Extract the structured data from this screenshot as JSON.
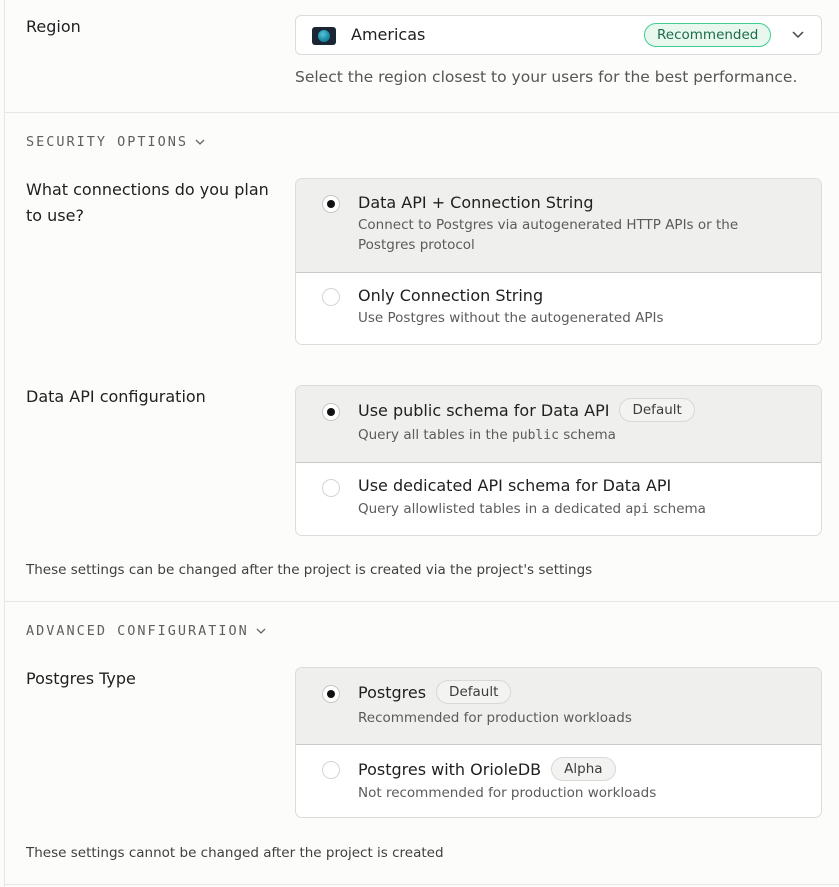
{
  "region": {
    "label": "Region",
    "value": "Americas",
    "badge": "Recommended",
    "help": "Select the region closest to your users for the best performance."
  },
  "security": {
    "heading": "SECURITY OPTIONS",
    "connections": {
      "label_line1": "What connections do you plan",
      "label_line2": "to use?",
      "options": [
        {
          "title": "Data API + Connection String",
          "desc": "Connect to Postgres via autogenerated HTTP APIs or the Postgres protocol",
          "selected": true
        },
        {
          "title": "Only Connection String",
          "desc": "Use Postgres without the autogenerated APIs",
          "selected": false
        }
      ]
    },
    "data_api": {
      "label": "Data API configuration",
      "options": [
        {
          "title": "Use public schema for Data API",
          "badge": "Default",
          "desc_pre": "Query all tables in the",
          "desc_code": "public",
          "desc_post": "schema",
          "selected": true
        },
        {
          "title": "Use dedicated API schema for Data API",
          "desc_pre": "Query allowlisted tables in a dedicated",
          "desc_code": "api",
          "desc_post": "schema",
          "selected": false
        }
      ]
    },
    "note": "These settings can be changed after the project is created via the project's settings"
  },
  "advanced": {
    "heading": "ADVANCED CONFIGURATION",
    "postgres_type": {
      "label": "Postgres Type",
      "options": [
        {
          "title": "Postgres",
          "badge": "Default",
          "desc": "Recommended for production workloads",
          "selected": true
        },
        {
          "title": "Postgres with OrioleDB",
          "badge": "Alpha",
          "desc": "Not recommended for production workloads",
          "selected": false
        }
      ]
    },
    "note": "These settings cannot be changed after the project is created"
  }
}
